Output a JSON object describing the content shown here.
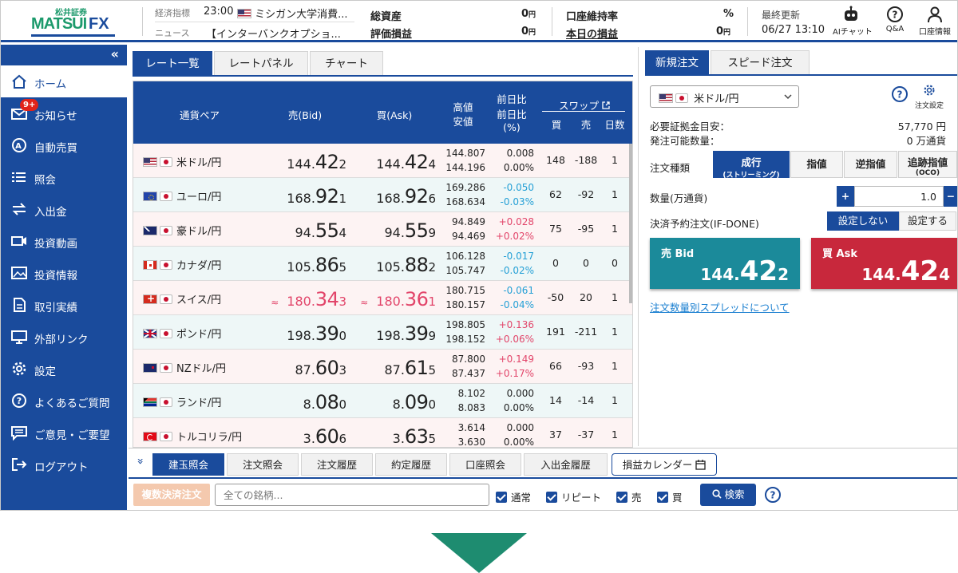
{
  "header": {
    "logo_small": "松井証券",
    "logo_main": "MATSUI",
    "logo_fx": "FX",
    "econ_label": "経済指標",
    "econ_time": "23:00",
    "econ_text": "ミシガン大学消費...",
    "news_label": "ニュース",
    "news_text": "【インターバンクオプショ...",
    "total_assets_label": "総資産",
    "total_assets_value": "0",
    "unit_yen": "円",
    "unrealized_label": "評価損益",
    "unrealized_value": "0",
    "margin_ratio_label": "口座維持率",
    "margin_ratio_value": "%",
    "today_pl_label": "本日の損益",
    "today_pl_value": "0",
    "last_update_label": "最終更新",
    "last_update_value": "06/27 13:10",
    "ai_chat_label": "AIチャット",
    "qa_label": "Q&A",
    "account_label": "口座情報"
  },
  "sidebar": {
    "collapse": "«",
    "items": [
      {
        "label": "ホーム"
      },
      {
        "label": "お知らせ",
        "badge": "9+"
      },
      {
        "label": "自動売買"
      },
      {
        "label": "照会"
      },
      {
        "label": "入出金"
      },
      {
        "label": "投資動画"
      },
      {
        "label": "投資情報"
      },
      {
        "label": "取引実績"
      },
      {
        "label": "外部リンク"
      },
      {
        "label": "設定"
      },
      {
        "label": "よくあるご質問"
      },
      {
        "label": "ご意見・ご要望"
      },
      {
        "label": "ログアウト"
      }
    ]
  },
  "main_tabs": [
    "レート一覧",
    "レートパネル",
    "チャート"
  ],
  "table": {
    "h_pair": "通貨ペア",
    "h_bid": "売(Bid)",
    "h_ask": "買(Ask)",
    "h_high": "高値",
    "h_low": "安値",
    "h_chg1": "前日比",
    "h_chg2": "前日比",
    "h_chg3": "(%)",
    "h_swap": "スワップ",
    "h_buy": "買",
    "h_sell": "売",
    "h_days": "日数",
    "rows": [
      {
        "pair": "米ドル/円",
        "flag": "us",
        "bid_a": "144.",
        "bid_b": "42",
        "bid_c": "2",
        "ask_a": "144.",
        "ask_b": "42",
        "ask_c": "4",
        "high": "144.807",
        "low": "144.196",
        "chg": "0.008",
        "chg_pct": "0.00%",
        "dir": "zero",
        "swap_buy": "148",
        "swap_sell": "-188",
        "days": "1",
        "up": false
      },
      {
        "pair": "ユーロ/円",
        "flag": "eu",
        "bid_a": "168.",
        "bid_b": "92",
        "bid_c": "1",
        "ask_a": "168.",
        "ask_b": "92",
        "ask_c": "6",
        "high": "169.286",
        "low": "168.634",
        "chg": "-0.050",
        "chg_pct": "-0.03%",
        "dir": "neg",
        "swap_buy": "62",
        "swap_sell": "-92",
        "days": "1",
        "up": false
      },
      {
        "pair": "豪ドル/円",
        "flag": "au",
        "bid_a": "94.",
        "bid_b": "55",
        "bid_c": "4",
        "ask_a": "94.",
        "ask_b": "55",
        "ask_c": "9",
        "high": "94.849",
        "low": "94.469",
        "chg": "+0.028",
        "chg_pct": "+0.02%",
        "dir": "pos",
        "swap_buy": "75",
        "swap_sell": "-95",
        "days": "1",
        "up": false
      },
      {
        "pair": "カナダ/円",
        "flag": "ca",
        "bid_a": "105.",
        "bid_b": "86",
        "bid_c": "5",
        "ask_a": "105.",
        "ask_b": "88",
        "ask_c": "2",
        "high": "106.128",
        "low": "105.747",
        "chg": "-0.017",
        "chg_pct": "-0.02%",
        "dir": "neg",
        "swap_buy": "0",
        "swap_sell": "0",
        "days": "0",
        "up": false
      },
      {
        "pair": "スイス/円",
        "flag": "ch",
        "bid_a": "180.",
        "bid_b": "34",
        "bid_c": "3",
        "ask_a": "180.",
        "ask_b": "36",
        "ask_c": "1",
        "high": "180.715",
        "low": "180.157",
        "chg": "-0.061",
        "chg_pct": "-0.04%",
        "dir": "neg",
        "swap_buy": "-50",
        "swap_sell": "20",
        "days": "1",
        "up": true
      },
      {
        "pair": "ポンド/円",
        "flag": "gb",
        "bid_a": "198.",
        "bid_b": "39",
        "bid_c": "0",
        "ask_a": "198.",
        "ask_b": "39",
        "ask_c": "9",
        "high": "198.805",
        "low": "198.152",
        "chg": "+0.136",
        "chg_pct": "+0.06%",
        "dir": "pos",
        "swap_buy": "191",
        "swap_sell": "-211",
        "days": "1",
        "up": false
      },
      {
        "pair": "NZドル/円",
        "flag": "nz",
        "bid_a": "87.",
        "bid_b": "60",
        "bid_c": "3",
        "ask_a": "87.",
        "ask_b": "61",
        "ask_c": "5",
        "high": "87.800",
        "low": "87.437",
        "chg": "+0.149",
        "chg_pct": "+0.17%",
        "dir": "pos",
        "swap_buy": "66",
        "swap_sell": "-93",
        "days": "1",
        "up": false
      },
      {
        "pair": "ランド/円",
        "flag": "za",
        "bid_a": "8.",
        "bid_b": "08",
        "bid_c": "0",
        "ask_a": "8.",
        "ask_b": "09",
        "ask_c": "0",
        "high": "8.102",
        "low": "8.083",
        "chg": "0.000",
        "chg_pct": "0.00%",
        "dir": "zero",
        "swap_buy": "14",
        "swap_sell": "-14",
        "days": "1",
        "up": false
      },
      {
        "pair": "トルコリラ/円",
        "flag": "tr",
        "bid_a": "3.",
        "bid_b": "60",
        "bid_c": "6",
        "ask_a": "3.",
        "ask_b": "63",
        "ask_c": "5",
        "high": "3.614",
        "low": "3.630",
        "chg": "0.000",
        "chg_pct": "0.00%",
        "dir": "zero",
        "swap_buy": "37",
        "swap_sell": "-37",
        "days": "1",
        "up": false
      }
    ]
  },
  "order": {
    "tabs": [
      "新規注文",
      "スピード注文"
    ],
    "pair": "米ドル/円",
    "settings_label": "注文設定",
    "margin_label": "必要証拠金目安：",
    "margin_value": "57,770 円",
    "available_label": "発注可能数量：",
    "available_value": "0 万通貨",
    "type_label": "注文種類",
    "type_market_1": "成行",
    "type_market_2": "(ストリーミング)",
    "type_limit": "指値",
    "type_stop": "逆指値",
    "type_oco_1": "追跡指値",
    "type_oco_2": "(OCO)",
    "qty_label": "数量(万通貨)",
    "qty_value": "1.0",
    "plus": "+",
    "minus": "−",
    "ifdone_label": "決済予約注文(IF-DONE)",
    "ifdone_off": "設定しない",
    "ifdone_on": "設定する",
    "sell_label": "売 Bid",
    "sell_a": "144.",
    "sell_b": "42",
    "sell_c": "2",
    "buy_label": "買 Ask",
    "buy_a": "144.",
    "buy_b": "42",
    "buy_c": "4",
    "spread_link": "注文数量別スプレッドについて"
  },
  "bottom": {
    "expand": "»",
    "tabs": [
      "建玉照会",
      "注文照会",
      "注文履歴",
      "約定履歴",
      "口座照会",
      "入出金履歴",
      "損益カレンダー"
    ],
    "bulk_settle": "複数決済注文",
    "search_placeholder": "全ての銘柄...",
    "filters": [
      "通常",
      "リピート",
      "売",
      "買"
    ],
    "search_button": "検索"
  },
  "colors": {
    "brand_blue": "#1a4b9c",
    "sell_teal": "#1b8a9a",
    "buy_red": "#c8283c",
    "up_pink": "#e2456a",
    "down_blue": "#25a0d6"
  }
}
